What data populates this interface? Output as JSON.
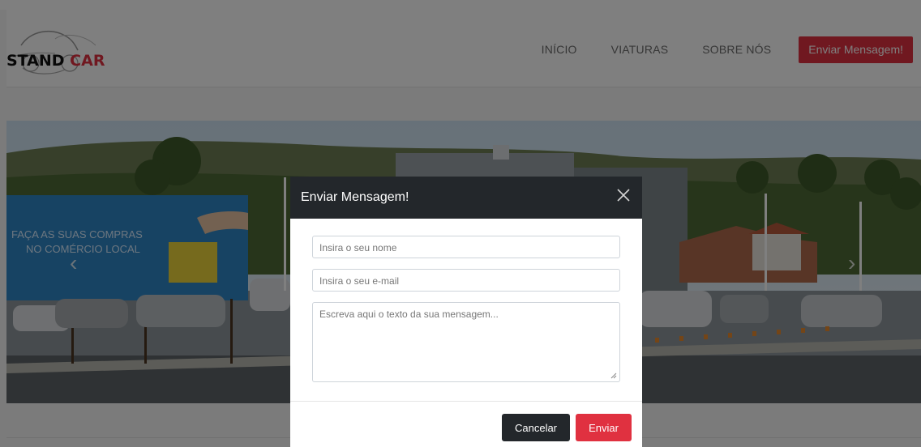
{
  "brand": {
    "part1": "STAND ",
    "part2": "CAR",
    "accent_color": "#e03140"
  },
  "nav": {
    "items": [
      {
        "label": "INÍCIO"
      },
      {
        "label": "VIATURAS"
      },
      {
        "label": "SOBRE NÓS"
      }
    ],
    "cta_label": "Enviar Mensagem!"
  },
  "hero": {
    "billboard_line1": "FAÇA AS SUAS COMPRAS",
    "billboard_line2": "NO COMÉRCIO LOCAL",
    "prev_icon": "chevron-left-icon",
    "next_icon": "chevron-right-icon"
  },
  "modal": {
    "title": "Enviar Mensagem!",
    "close_icon": "close-icon",
    "name_placeholder": "Insira o seu nome",
    "email_placeholder": "Insira o seu e-mail",
    "message_placeholder": "Escreva aqui o texto da sua mensagem...",
    "cancel_label": "Cancelar",
    "send_label": "Enviar"
  }
}
